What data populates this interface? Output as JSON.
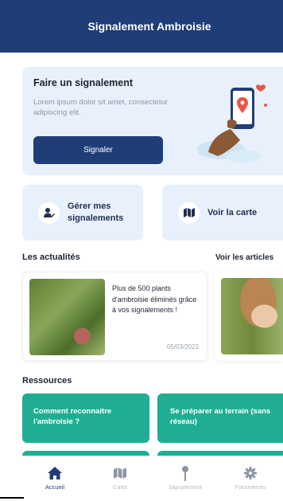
{
  "header": {
    "title": "Signalement Ambroisie"
  },
  "report_card": {
    "title": "Faire un signalement",
    "text": "Lorem ipsum dolor sit amet, consectetur adipiscing elit.",
    "button_label": "Signaler"
  },
  "actions": [
    {
      "label": "Gérer mes signalements",
      "icon": "user-edit-icon"
    },
    {
      "label": "Voir la carte",
      "icon": "map-icon"
    }
  ],
  "news": {
    "title": "Les actualités",
    "link_label": "Voir les articles",
    "articles": [
      {
        "text": "Plus de 500 plants d'ambroisie éliminés grâce à vos signalements !",
        "date": "05/03/2022"
      }
    ]
  },
  "resources": {
    "title": "Ressources",
    "items": [
      {
        "label": "Comment reconnaitre l'ambroisie ?"
      },
      {
        "label": "Se préparer au terrain (sans réseau)"
      }
    ]
  },
  "tabbar": {
    "tabs": [
      {
        "label": "Accueil",
        "icon": "home-icon",
        "active": true
      },
      {
        "label": "Carte",
        "icon": "map-icon",
        "active": false
      },
      {
        "label": "Signalement",
        "icon": "pin-icon",
        "active": false
      },
      {
        "label": "Paramètres",
        "icon": "gear-icon",
        "active": false
      }
    ]
  },
  "colors": {
    "primary": "#1f3e78",
    "card_bg": "#e8f0fb",
    "resource": "#1fae94",
    "accent_red": "#e8564a"
  }
}
